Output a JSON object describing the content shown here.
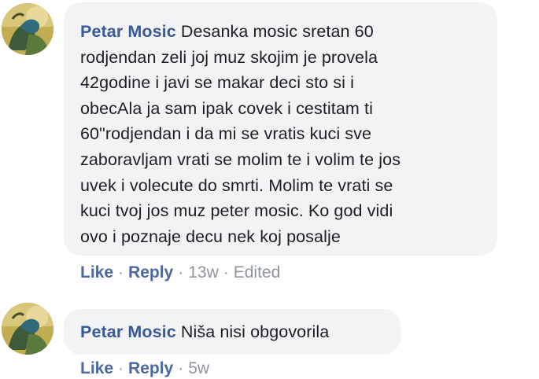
{
  "comments": [
    {
      "author": "Petar Mosic",
      "text_lines": [
        "Desanka mosic sretan 60",
        "rodjendan zeli joj muz skojim je provela",
        "42godine i javi se makar deci sto si i",
        "obecAla ja sam ipak covek i cestitam ti",
        "60\"rodjendan i da mi se vratis kuci sve",
        "zaboravljam vrati se molim te i volim te jos",
        "uvek i volecute do smrti. Molim te vrati se",
        "kuci tvoj jos muz peter mosic. Ko god vidi",
        "ovo i poznaje decu nek koj posalje"
      ],
      "like_label": "Like",
      "reply_label": "Reply",
      "separator": "·",
      "time": "13w",
      "edited_label": "Edited"
    },
    {
      "author": "Petar Mosic",
      "text_lines": [
        "Niša nisi obgovorila"
      ],
      "like_label": "Like",
      "reply_label": "Reply",
      "separator": "·",
      "time": "5w"
    }
  ],
  "colors": {
    "author": "#385898",
    "action_link": "#4b67a1",
    "meta": "#90949c",
    "bubble_bg": "#f2f3f5",
    "text": "#1c1e21"
  }
}
